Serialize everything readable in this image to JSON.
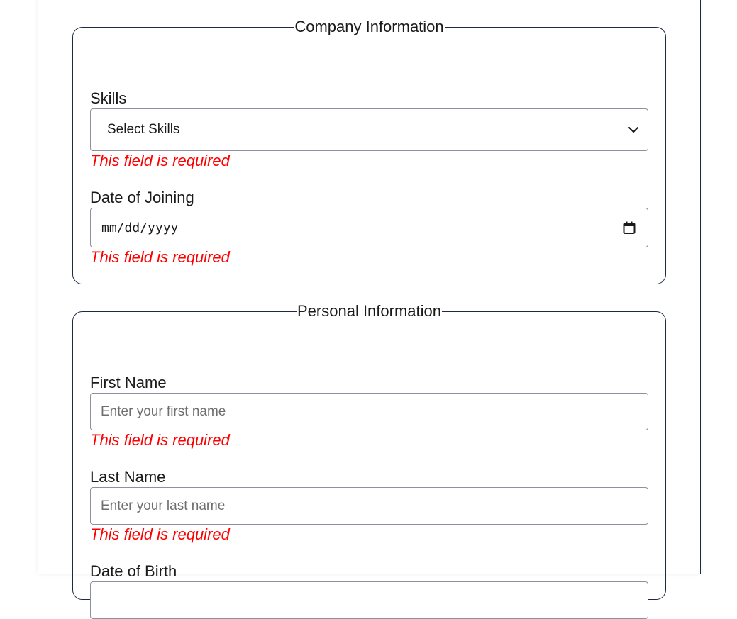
{
  "company_section": {
    "legend": "Company Information",
    "skills": {
      "label": "Skills",
      "selected_value": "Select Skills",
      "error": "This field is required"
    },
    "date_of_joining": {
      "label": "Date of Joining",
      "value_mask": "mm/dd/yyyy",
      "error": "This field is required"
    }
  },
  "personal_section": {
    "legend": "Personal Information",
    "first_name": {
      "label": "First Name",
      "placeholder": "Enter your first name",
      "error": "This field is required"
    },
    "last_name": {
      "label": "Last Name",
      "placeholder": "Enter your last name",
      "error": "This field is required"
    },
    "date_of_birth": {
      "label": "Date of Birth"
    }
  },
  "colors": {
    "border": "#1e2a44",
    "error": "#ff0000",
    "input_border": "#8f8f9d",
    "placeholder": "#6e6e6e"
  },
  "icons": {
    "select": "chevron-down-icon",
    "date": "calendar-icon"
  }
}
